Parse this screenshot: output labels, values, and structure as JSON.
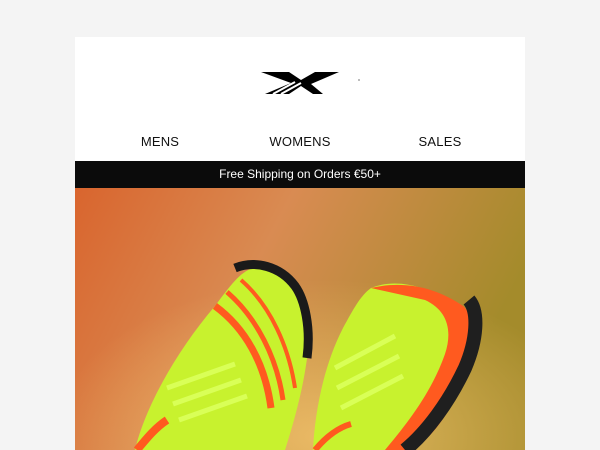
{
  "brand": {
    "logo_icon": "reebok-vector-logo-icon"
  },
  "nav": {
    "items": [
      {
        "label": "MENS"
      },
      {
        "label": "WOMENS"
      },
      {
        "label": "SALES"
      }
    ]
  },
  "banner": {
    "shipping_text": "Free Shipping on Orders €50+"
  },
  "hero": {
    "image": "product-photo-neon-running-shoes",
    "colors": {
      "background_left": "#e06a32",
      "background_right": "#a6902c",
      "shoe_upper": "#c6f12a",
      "shoe_accent": "#ff5a1f",
      "sole": "#1a1a1a"
    }
  }
}
